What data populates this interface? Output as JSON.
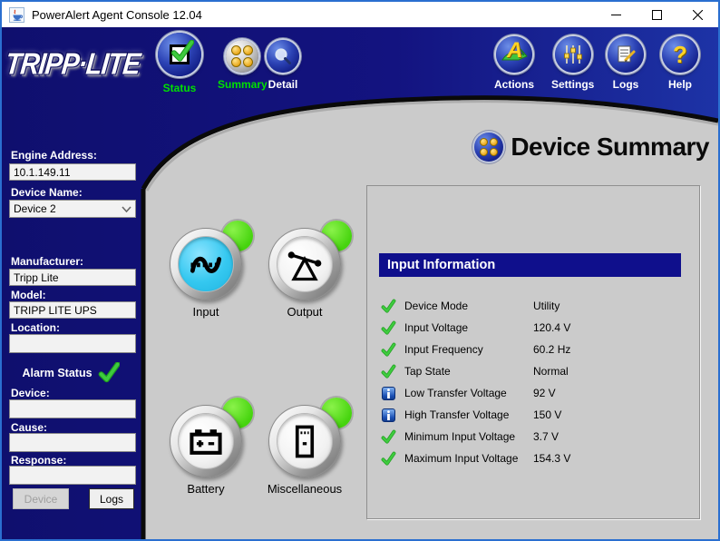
{
  "window": {
    "title": "PowerAlert Agent Console 12.04"
  },
  "toolbar": {
    "nav": [
      {
        "label": "Status"
      },
      {
        "label": "Summary"
      },
      {
        "label": "Detail"
      }
    ],
    "actions": [
      {
        "label": "Actions"
      },
      {
        "label": "Settings"
      },
      {
        "label": "Logs"
      },
      {
        "label": "Help"
      }
    ],
    "actions_glyph": "A",
    "help_glyph": "?"
  },
  "logo": {
    "text": "TRIPP·LITE"
  },
  "sidebar": {
    "engine_address_label": "Engine Address:",
    "engine_address": "10.1.149.11",
    "device_name_label": "Device Name:",
    "device_name": "Device 2",
    "manufacturer_label": "Manufacturer:",
    "manufacturer": "Tripp Lite",
    "model_label": "Model:",
    "model": "TRIPP LITE UPS",
    "location_label": "Location:",
    "location": "",
    "alarm_status_label": "Alarm Status",
    "device_label": "Device:",
    "device": "",
    "cause_label": "Cause:",
    "cause": "",
    "response_label": "Response:",
    "response": "",
    "device_button": "Device",
    "logs_button": "Logs"
  },
  "main": {
    "title": "Device Summary",
    "devices": [
      {
        "label": "Input",
        "active": true
      },
      {
        "label": "Output",
        "active": false
      },
      {
        "label": "Battery",
        "active": false
      },
      {
        "label": "Miscellaneous",
        "active": false
      }
    ],
    "panel": {
      "title": "Input Information",
      "rows": [
        {
          "icon": "check",
          "label": "Device Mode",
          "value": "Utility"
        },
        {
          "icon": "check",
          "label": "Input Voltage",
          "value": "120.4 V"
        },
        {
          "icon": "check",
          "label": "Input Frequency",
          "value": "60.2 Hz"
        },
        {
          "icon": "check",
          "label": "Tap State",
          "value": "Normal"
        },
        {
          "icon": "info",
          "label": "Low Transfer Voltage",
          "value": "92 V"
        },
        {
          "icon": "info",
          "label": "High Transfer Voltage",
          "value": "150 V"
        },
        {
          "icon": "check",
          "label": "Minimum Input Voltage",
          "value": "3.7 V"
        },
        {
          "icon": "check",
          "label": "Maximum Input Voltage",
          "value": "154.3 V"
        }
      ]
    }
  },
  "colors": {
    "navy_background": "#131380",
    "banner_blue": "#0f0f8c",
    "content_gray": "#cbcbcb",
    "status_green": "#2db52d",
    "indicator_green_dot": "#46d40e",
    "active_cyan": "#35c8f0",
    "nav_label_green": "#00e100",
    "window_border_blue": "#2a6fd0"
  }
}
